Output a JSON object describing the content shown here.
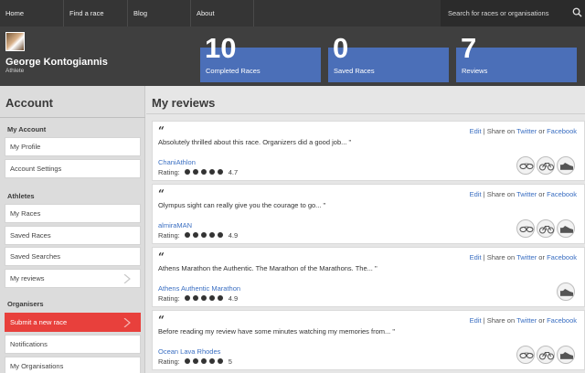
{
  "nav": {
    "items": [
      "Home",
      "Find a race",
      "Blog",
      "About"
    ],
    "search_placeholder": "Search for races or organisations",
    "search_icon": "search-icon"
  },
  "profile": {
    "name": "George Kontogiannis",
    "role": "Athlete"
  },
  "stats": [
    {
      "value": "10",
      "label": "Completed Races"
    },
    {
      "value": "0",
      "label": "Saved Races"
    },
    {
      "value": "7",
      "label": "Reviews"
    }
  ],
  "sidebar": {
    "title": "Account",
    "sections": [
      {
        "label": "My Account",
        "items": [
          "My Profile",
          "Account Settings"
        ]
      },
      {
        "label": "Athletes",
        "items": [
          "My Races",
          "Saved Races",
          "Saved Searches",
          "My reviews"
        ]
      },
      {
        "label": "Organisers",
        "items": [
          "Submit a new race",
          "Notifications",
          "My Organisations"
        ]
      }
    ]
  },
  "main": {
    "title": "My reviews",
    "actions": {
      "edit": "Edit",
      "share_prefix": "Share on",
      "twitter": "Twitter",
      "or": "or",
      "facebook": "Facebook"
    },
    "rating_label": "Rating:",
    "reviews": [
      {
        "text": "Absolutely thrilled about this race. Organizers did a good job... \"",
        "reviewer": "ChaniAthlon",
        "rating": "4.7",
        "icons": [
          "swim-goggles-icon",
          "bike-icon",
          "running-shoe-icon"
        ]
      },
      {
        "text": "Olympus sight can really give you the courage to go... \"",
        "reviewer": "almiraMAN",
        "rating": "4.9",
        "icons": [
          "swim-goggles-icon",
          "bike-icon",
          "running-shoe-icon"
        ]
      },
      {
        "text": "Athens Marathon the Authentic. The Marathon of the Marathons. The... \"",
        "reviewer": "Athens Authentic Marathon",
        "rating": "4.9",
        "icons": [
          "running-shoe-icon"
        ]
      },
      {
        "text": "Before reading my review have some minutes watching my memories from... \"",
        "reviewer": "Ocean Lava Rhodes",
        "rating": "5",
        "icons": [
          "swim-goggles-icon",
          "bike-icon",
          "running-shoe-icon"
        ]
      }
    ]
  },
  "colors": {
    "accent_blue": "#4b6fb8",
    "active_red": "#e8403c",
    "link": "#3b6fc2"
  }
}
